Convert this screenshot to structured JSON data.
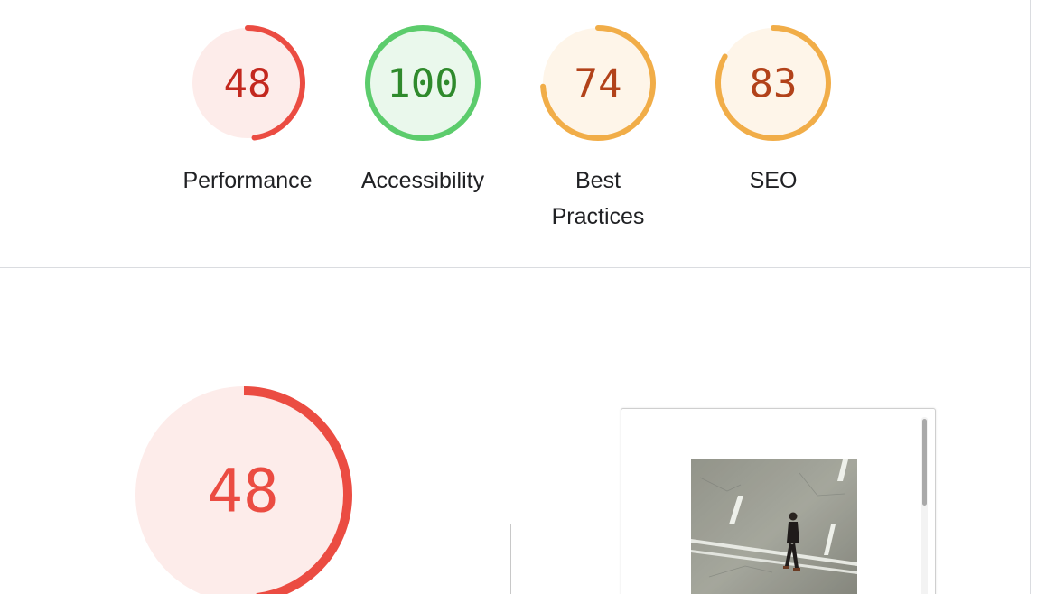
{
  "categories": [
    {
      "id": "performance",
      "label": "Performance",
      "score": "48",
      "fraction": 0.48,
      "color": "#eb4c42",
      "fill": "#fdecea",
      "text_color": "#c3281f"
    },
    {
      "id": "accessibility",
      "label": "Accessibility",
      "score": "100",
      "fraction": 1.0,
      "color": "#5ccc6c",
      "fill": "#eaf8ec",
      "text_color": "#2f8a2c"
    },
    {
      "id": "best-practices",
      "label": "Best Practices",
      "score": "74",
      "fraction": 0.74,
      "color": "#f1ad48",
      "fill": "#fef5e9",
      "text_color": "#b2421a"
    },
    {
      "id": "seo",
      "label": "SEO",
      "score": "83",
      "fraction": 0.83,
      "color": "#f1ad48",
      "fill": "#fef5e9",
      "text_color": "#b2421a"
    }
  ],
  "main_gauge": {
    "score": "48",
    "fraction": 0.48,
    "color": "#eb4c42",
    "fill": "#fdecea",
    "text_color": "#eb4c42"
  },
  "screenshot": {
    "thumbnail_icon": "street-photo-thumbnail"
  }
}
